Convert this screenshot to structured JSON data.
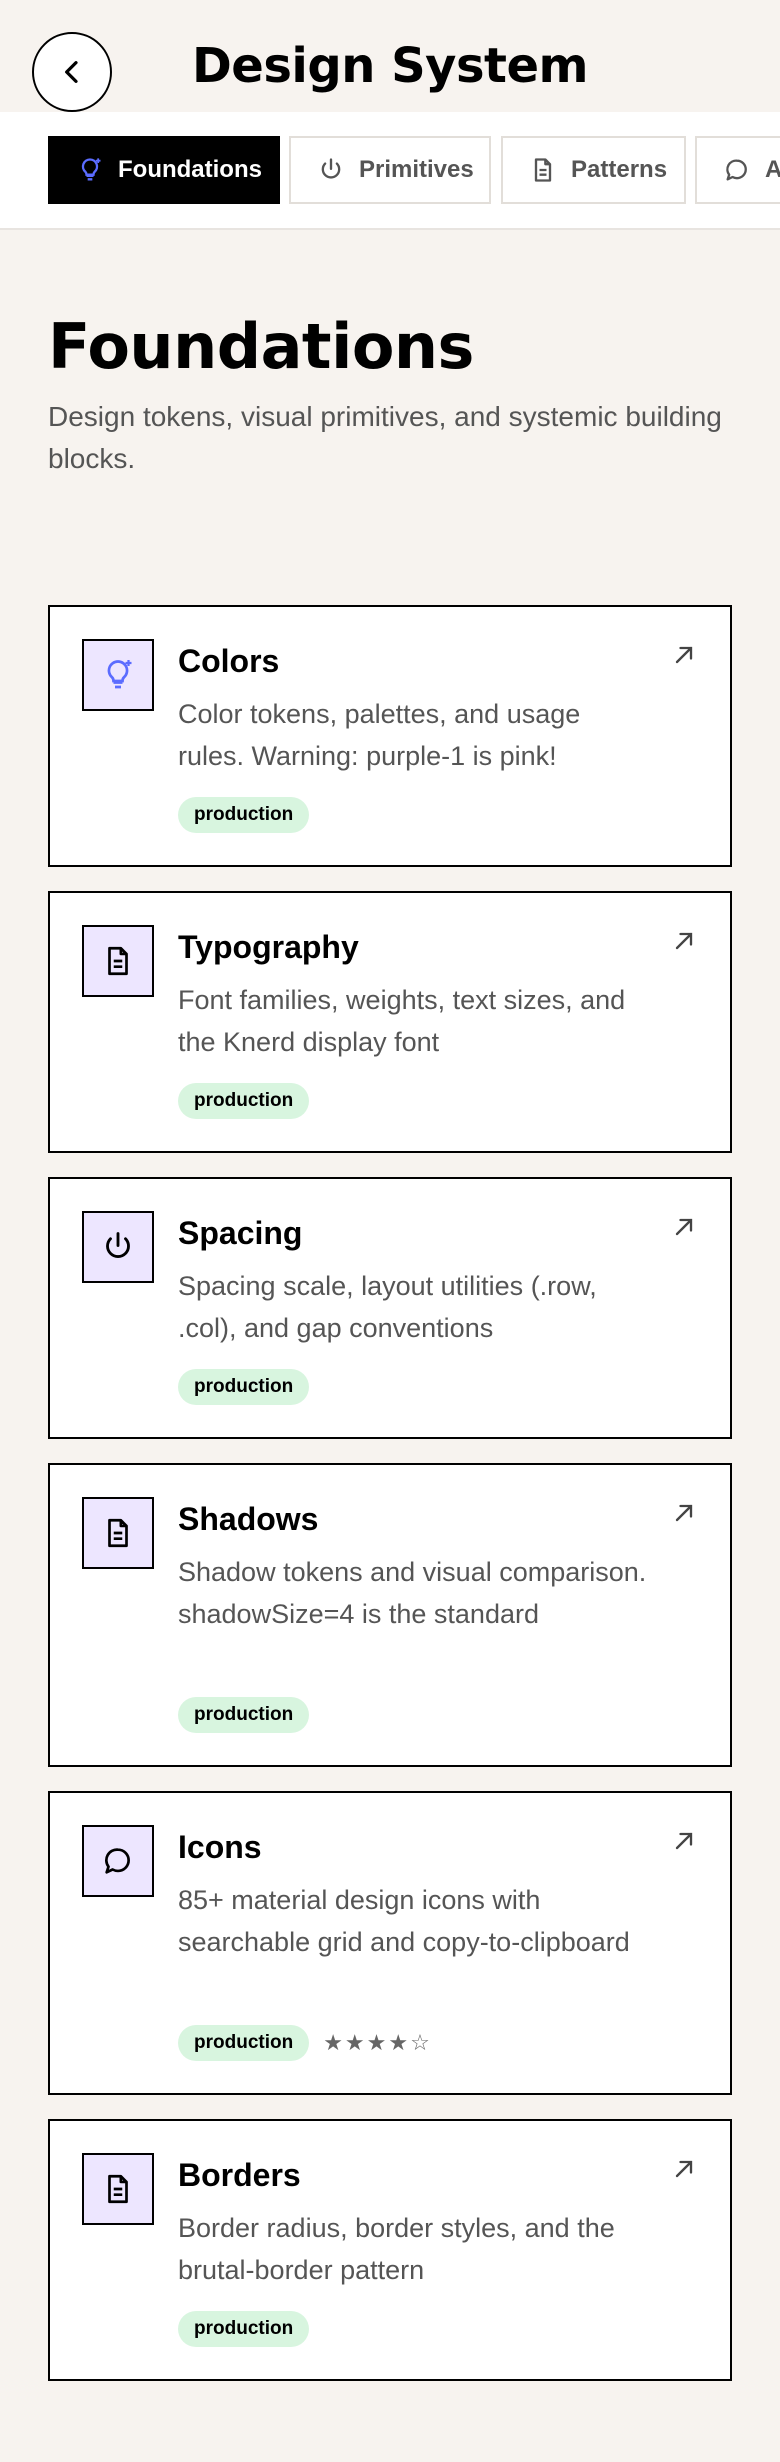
{
  "header": {
    "title": "Design System",
    "back_icon": "chevron-left-icon"
  },
  "tabs": [
    {
      "label": "Foundations",
      "icon": "lightbulb-icon",
      "active": true
    },
    {
      "label": "Primitives",
      "icon": "power-icon",
      "active": false
    },
    {
      "label": "Patterns",
      "icon": "document-icon",
      "active": false
    },
    {
      "label": "Au",
      "icon": "chat-bubble-icon",
      "active": false
    }
  ],
  "section": {
    "title": "Foundations",
    "description": "Design tokens, visual primitives, and systemic building blocks."
  },
  "colors": {
    "accent_icon": "#5b6cff",
    "icon_bg": "#ede6ff",
    "badge_bg": "#d8f5df"
  },
  "cards": [
    {
      "title": "Colors",
      "icon": "lightbulb-icon",
      "description": "Color tokens, palettes, and usage rules. Warning: purple-1 is pink!",
      "badge": "production"
    },
    {
      "title": "Typography",
      "icon": "document-icon",
      "description": "Font families, weights, text sizes, and the Knerd display font",
      "badge": "production"
    },
    {
      "title": "Spacing",
      "icon": "power-icon",
      "description": "Spacing scale, layout utilities (.row, .col), and gap conventions",
      "badge": "production"
    },
    {
      "title": "Shadows",
      "icon": "document-icon",
      "description": "Shadow tokens and visual comparison. shadowSize=4 is the standard",
      "badge": "production"
    },
    {
      "title": "Icons",
      "icon": "chat-bubble-icon",
      "description": "85+ material design icons with searchable grid and copy-to-clipboard",
      "badge": "production",
      "rating": "★★★★☆",
      "rating_value": 4
    },
    {
      "title": "Borders",
      "icon": "document-icon",
      "description": "Border radius, border styles, and the brutal-border pattern",
      "badge": "production"
    }
  ]
}
